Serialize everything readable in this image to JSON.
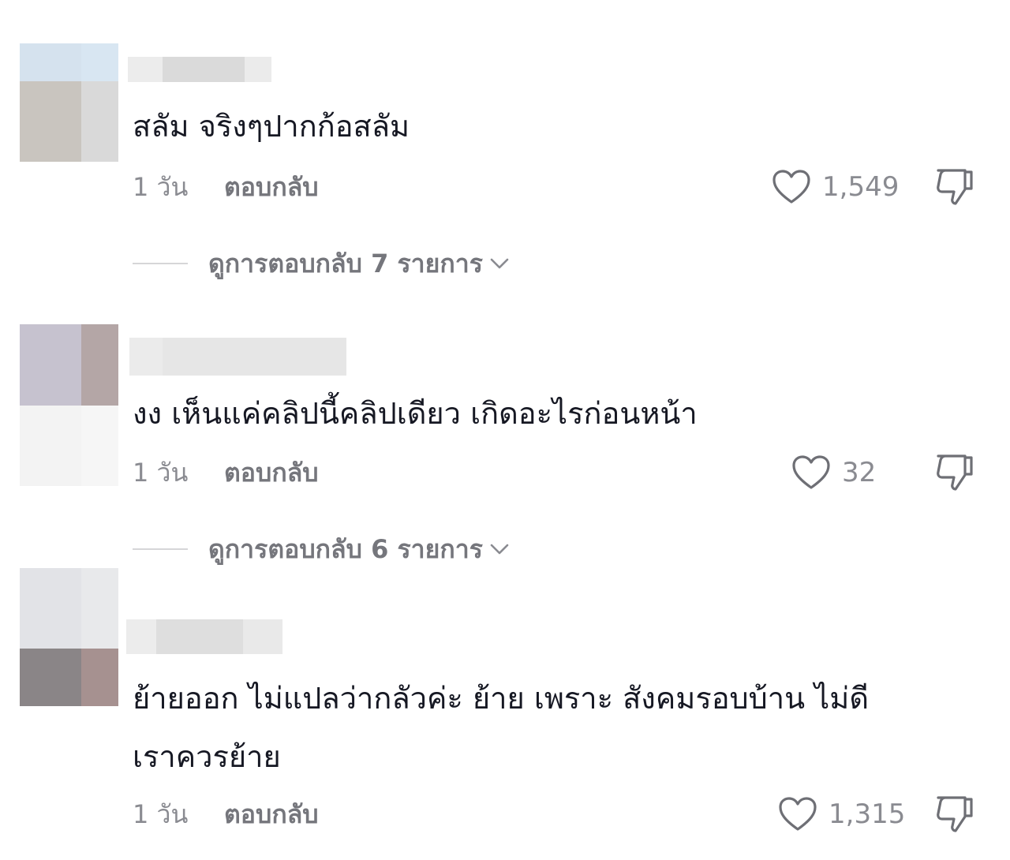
{
  "comments": [
    {
      "text": "สลัม จริงๆปากก้อสลัม",
      "time": "1 วัน",
      "reply": "ตอบกลับ",
      "likes": "1,549",
      "view_replies": "ดูการตอบกลับ 7 รายการ"
    },
    {
      "text": "งง เห็นแค่คลิปนี้คลิปเดียว เกิดอะไรก่อนหน้า",
      "time": "1 วัน",
      "reply": "ตอบกลับ",
      "likes": "32",
      "view_replies": "ดูการตอบกลับ 6 รายการ"
    },
    {
      "text": "ย้ายออก ไม่แปลว่ากลัวค่ะ ย้าย เพราะ สังคมรอบบ้าน ไม่ดี\nเราควรย้าย",
      "time": "1 วัน",
      "reply": "ตอบกลับ",
      "likes": "1,315"
    }
  ],
  "icons": {
    "like": "heart-outline-icon",
    "dislike": "thumbs-down-icon",
    "expand": "chevron-down-icon"
  },
  "colors": {
    "text": "#161823",
    "secondary": "#8a8b91",
    "icon": "#6e6f75"
  }
}
